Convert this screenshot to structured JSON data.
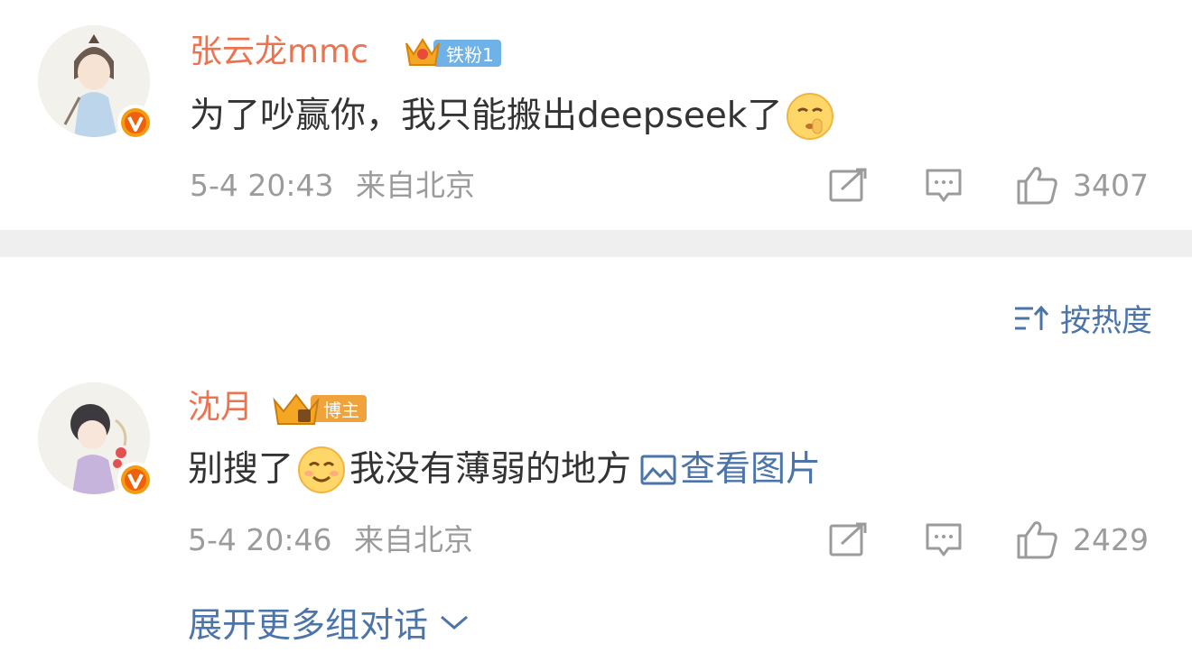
{
  "comments": [
    {
      "username": "张云龙mmc",
      "badge": {
        "label": "铁粉1",
        "color": "#6fb2e8"
      },
      "text_before": "为了吵赢你，我只能搬出deepseek了",
      "emoji_name": "shush-emoji",
      "text_after": "",
      "time": "5-4 20:43",
      "location": "来自北京",
      "likes": "3407"
    },
    {
      "username": "沈月",
      "badge": {
        "label": "博主",
        "color": "#f0a33a"
      },
      "text_before": "别搜了",
      "emoji_name": "smile-emoji",
      "text_after": "我没有薄弱的地方",
      "view_image": "查看图片",
      "time": "5-4 20:46",
      "location": "来自北京",
      "likes": "2429"
    }
  ],
  "sort": {
    "label": "按热度"
  },
  "expand": {
    "label": "展开更多组对话"
  },
  "colors": {
    "username": "#eb7350",
    "link": "#4b74a8",
    "meta": "#9b9b9b",
    "divider": "#efefef",
    "verified": "#f0600a"
  },
  "icons": [
    "verified-v-icon",
    "crown-icon",
    "repost-icon",
    "comment-icon",
    "like-icon",
    "sort-icon",
    "image-icon",
    "chevron-down-icon"
  ]
}
